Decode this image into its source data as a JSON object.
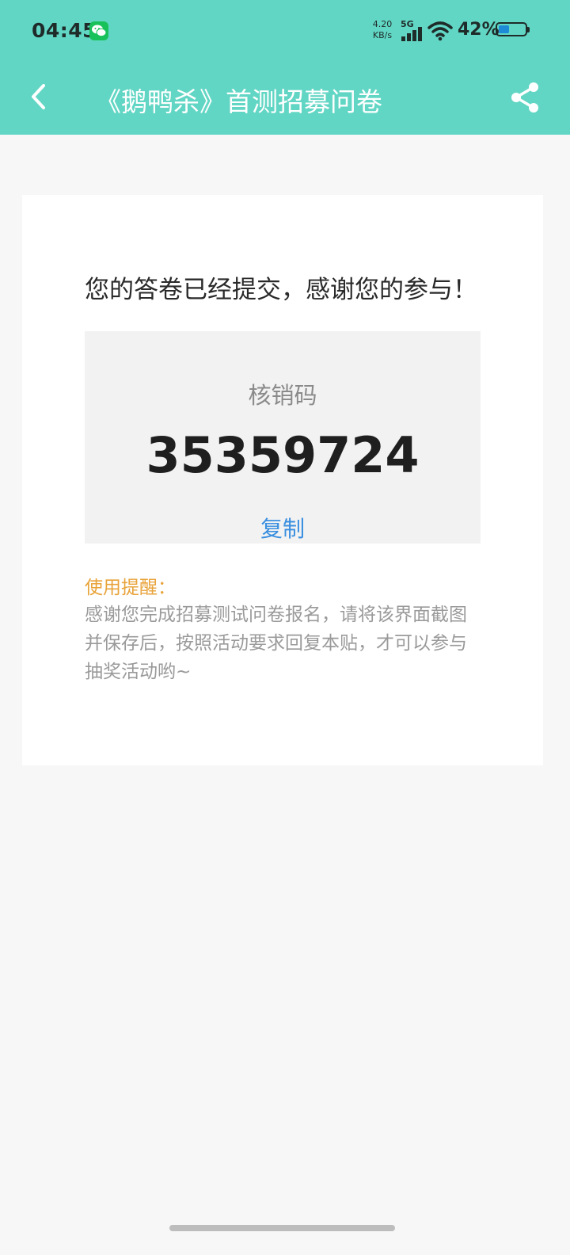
{
  "status_bar": {
    "time": "04:45",
    "net_speed_value": "4.20",
    "net_speed_unit": "KB/s",
    "network": "5G",
    "battery_percent": "42%",
    "battery_level": 0.42
  },
  "header": {
    "title": "《鹅鸭杀》首测招募问卷"
  },
  "result": {
    "message": "您的答卷已经提交，感谢您的参与！",
    "code_label": "核销码",
    "code_value": "35359724",
    "copy_label": "复制"
  },
  "reminder": {
    "title": "使用提醒：",
    "text": "感谢您完成招募测试问卷报名，请将该界面截图并保存后，按照活动要求回复本贴，才可以参与抽奖活动哟~"
  },
  "colors": {
    "header_bg": "#62d6c4",
    "accent_blue": "#3a8fe0",
    "reminder_orange": "#e8a33a"
  },
  "icons": {
    "back": "chevron-left-icon",
    "share": "share-icon",
    "wechat": "wechat-icon",
    "signal": "signal-icon",
    "wifi": "wifi-icon",
    "battery": "battery-icon"
  }
}
